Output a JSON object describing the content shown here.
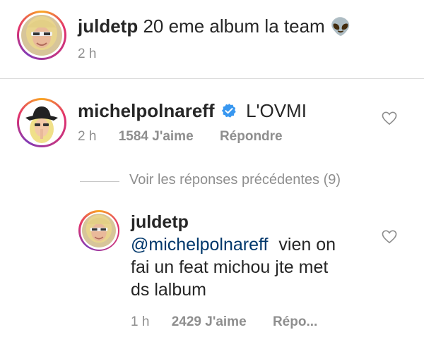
{
  "caption": {
    "username": "juldetp",
    "text": "20 eme album la team",
    "emoji": "👽",
    "time": "2 h"
  },
  "comment": {
    "username": "michelpolnareff",
    "verified": true,
    "text": "L'OVMI",
    "time": "2 h",
    "likes": "1584 J'aime",
    "reply_label": "Répondre"
  },
  "view_replies": "Voir les réponses précédentes (9)",
  "reply": {
    "username": "juldetp",
    "mention": "@michelpolnareff",
    "text_line1": "vien on",
    "text_line2": "fai un feat michou jte met",
    "text_line3": "ds lalbum",
    "time": "1 h",
    "likes": "2429 J'aime",
    "reply_label": "Répo..."
  },
  "colors": {
    "verified": "#3897f0",
    "meta_gray": "#8e8e8e",
    "mention_blue": "#00376b"
  }
}
